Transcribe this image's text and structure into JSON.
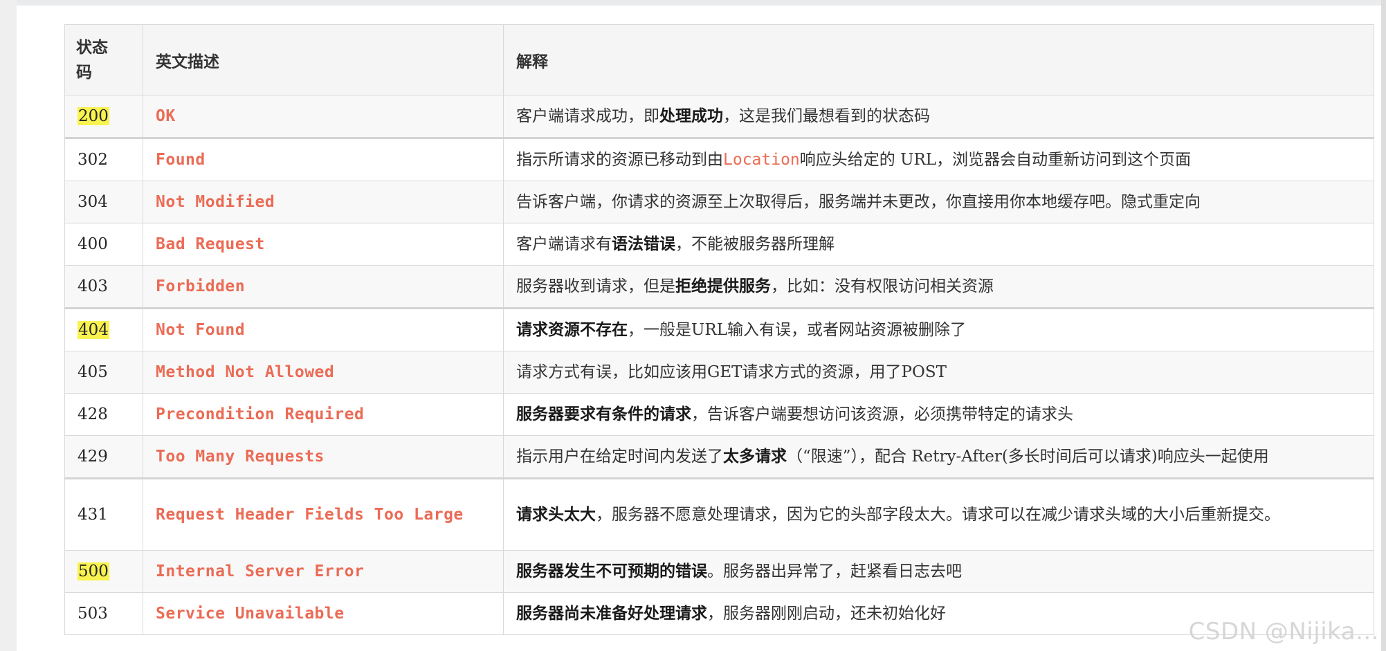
{
  "table": {
    "headers": {
      "code": "状态码",
      "english": "英文描述",
      "explanation": "解释"
    },
    "rows": [
      {
        "code": "200",
        "highlight": true,
        "english": "OK",
        "explanation": [
          {
            "t": "客户端请求成功，即"
          },
          {
            "t": "处理成功",
            "b": true
          },
          {
            "t": "，这是我们最想看到的状态码"
          }
        ]
      },
      {
        "code": "302",
        "highlight": false,
        "english": "Found",
        "explanation": [
          {
            "t": "指示所请求的资源已移动到由"
          },
          {
            "t": "Location",
            "m": true
          },
          {
            "t": "响应头给定的 URL，浏览器会自动重新访问到这个页面"
          }
        ]
      },
      {
        "code": "304",
        "highlight": false,
        "english": "Not Modified",
        "explanation": [
          {
            "t": "告诉客户端，你请求的资源至上次取得后，服务端并未更改，你直接用你本地缓存吧。隐式重定向"
          }
        ]
      },
      {
        "code": "400",
        "highlight": false,
        "english": "Bad Request",
        "explanation": [
          {
            "t": "客户端请求有"
          },
          {
            "t": "语法错误",
            "b": true
          },
          {
            "t": "，不能被服务器所理解"
          }
        ]
      },
      {
        "code": "403",
        "highlight": false,
        "english": "Forbidden",
        "explanation": [
          {
            "t": "服务器收到请求，但是"
          },
          {
            "t": "拒绝提供服务",
            "b": true
          },
          {
            "t": "，比如：没有权限访问相关资源"
          }
        ]
      },
      {
        "code": "404",
        "highlight": true,
        "english": "Not Found",
        "explanation": [
          {
            "t": "请求资源不存在",
            "b": true
          },
          {
            "t": "，一般是URL输入有误，或者网站资源被删除了"
          }
        ]
      },
      {
        "code": "405",
        "highlight": false,
        "english": "Method Not Allowed",
        "explanation": [
          {
            "t": "请求方式有误，比如应该用GET请求方式的资源，用了POST"
          }
        ]
      },
      {
        "code": "428",
        "highlight": false,
        "english": "Precondition Required",
        "explanation": [
          {
            "t": "服务器要求有条件的请求",
            "b": true
          },
          {
            "t": "，告诉客户端要想访问该资源，必须携带特定的请求头"
          }
        ]
      },
      {
        "code": "429",
        "highlight": false,
        "english": "Too Many Requests",
        "explanation": [
          {
            "t": "指示用户在给定时间内发送了"
          },
          {
            "t": "太多请求",
            "b": true
          },
          {
            "t": "（“限速”），配合 Retry-After(多长时间后可以请求)响应头一起使用"
          }
        ]
      },
      {
        "code": "431",
        "highlight": false,
        "english": "Request Header Fields Too Large",
        "explanation": [
          {
            "t": "请求头太大",
            "b": true
          },
          {
            "t": "，服务器不愿意处理请求，因为它的头部字段太大。请求可以在减少请求头域的大小后重新提交。"
          }
        ]
      },
      {
        "code": "500",
        "highlight": true,
        "english": "Internal Server Error",
        "explanation": [
          {
            "t": "服务器发生不可预期的错误",
            "b": true
          },
          {
            "t": "。服务器出异常了，赶紧看日志去吧"
          }
        ]
      },
      {
        "code": "503",
        "highlight": false,
        "english": "Service Unavailable",
        "explanation": [
          {
            "t": "服务器尚未准备好处理请求",
            "b": true
          },
          {
            "t": "，服务器刚刚启动，还未初始化好"
          }
        ]
      }
    ]
  },
  "watermark": "CSDN @Nijika...",
  "colors": {
    "highlight": "#f8f34e",
    "english_text": "#eb6b55",
    "header_bg": "#f5f5f5"
  }
}
